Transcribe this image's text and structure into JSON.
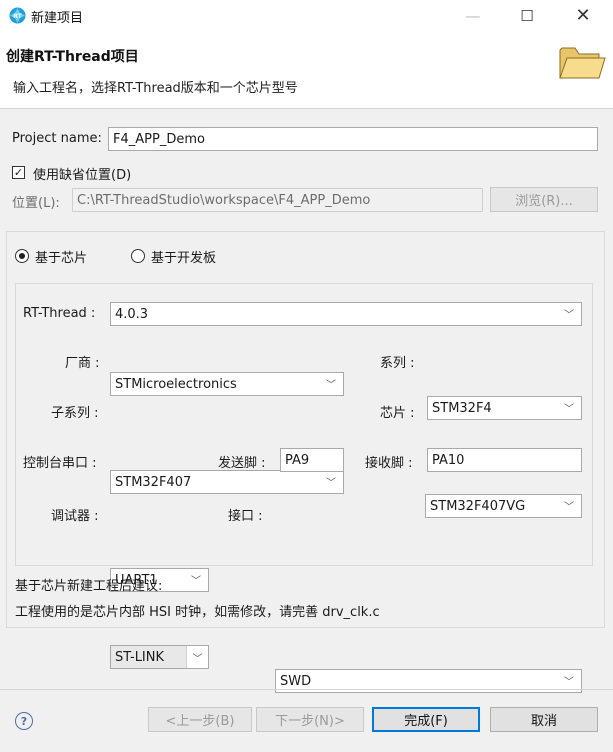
{
  "window": {
    "title": "新建项目",
    "minimize": "—",
    "maximize": "☐",
    "close": "✕"
  },
  "banner": {
    "title": "创建RT-Thread项目",
    "description": "输入工程名，选择RT-Thread版本和一个芯片型号"
  },
  "project": {
    "name_label": "Project name:",
    "name_value": "F4_APP_Demo",
    "use_default_label": "使用缺省位置(D)",
    "use_default_checked": true,
    "location_label": "位置(L):",
    "location_value": "C:\\RT-ThreadStudio\\workspace\\F4_APP_Demo",
    "browse_label": "浏览(R)..."
  },
  "mode": {
    "chip_label": "基于芯片",
    "board_label": "基于开发板",
    "selected": "chip"
  },
  "config": {
    "rtthread_label": "RT-Thread :",
    "rtthread_value": "4.0.3",
    "vendor_label": "厂商 :",
    "vendor_value": "STMicroelectronics",
    "series_label": "系列 :",
    "series_value": "STM32F4",
    "subseries_label": "子系列 :",
    "subseries_value": "STM32F407",
    "chip_label": "芯片 :",
    "chip_value": "STM32F407VG",
    "console_label": "控制台串口 :",
    "console_value": "UART1",
    "tx_label": "发送脚 :",
    "tx_value": "PA9",
    "rx_label": "接收脚 :",
    "rx_value": "PA10",
    "debugger_label": "调试器 :",
    "debugger_value": "ST-LINK",
    "interface_label": "接口 :",
    "interface_value": "SWD"
  },
  "advice": {
    "heading": "基于芯片新建工程后建议:",
    "text": "工程使用的是芯片内部 HSI 时钟，如需修改，请完善 drv_clk.c"
  },
  "footer": {
    "help": "?",
    "back": "<上一步(B)",
    "next": "下一步(N)>",
    "finish": "完成(F)",
    "cancel": "取消"
  },
  "colors": {
    "accent": "#0078d7",
    "window_bg": "#f0f0f0",
    "banner_bg": "#ffffff"
  }
}
